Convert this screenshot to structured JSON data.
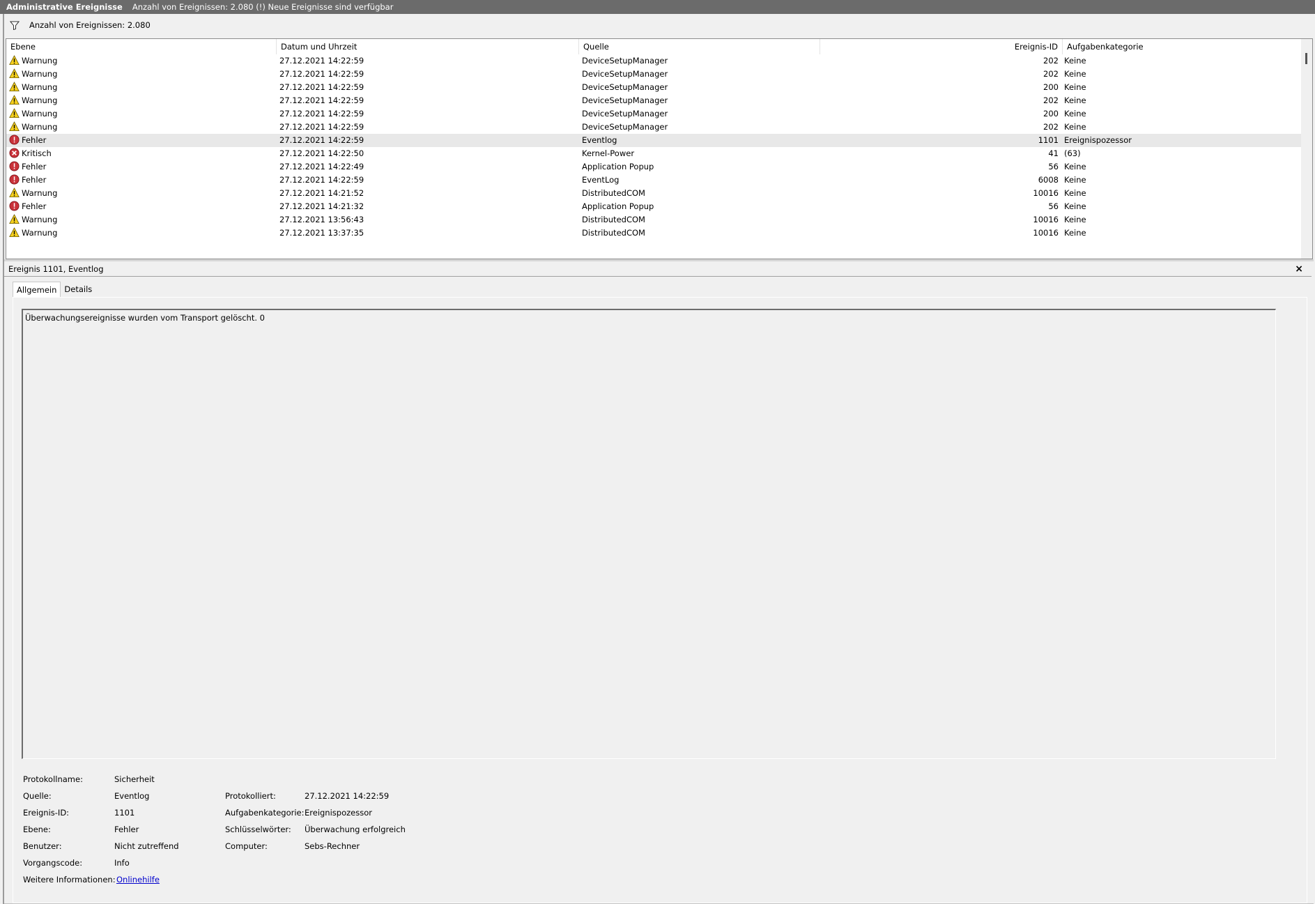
{
  "titlebar": {
    "title": "Administrative Ereignisse",
    "status": "Anzahl von Ereignissen: 2.080 (!) Neue Ereignisse sind verfügbar"
  },
  "filterbar": {
    "text": "Anzahl von Ereignissen: 2.080",
    "icon": "filter-icon"
  },
  "grid": {
    "columns": [
      "Ebene",
      "Datum und Uhrzeit",
      "Quelle",
      "Ereignis-ID",
      "Aufgabenkategorie"
    ],
    "rows": [
      {
        "level": "Warnung",
        "icon": "warning",
        "date": "27.12.2021 14:22:59",
        "source": "DeviceSetupManager",
        "id": "202",
        "category": "Keine"
      },
      {
        "level": "Warnung",
        "icon": "warning",
        "date": "27.12.2021 14:22:59",
        "source": "DeviceSetupManager",
        "id": "202",
        "category": "Keine"
      },
      {
        "level": "Warnung",
        "icon": "warning",
        "date": "27.12.2021 14:22:59",
        "source": "DeviceSetupManager",
        "id": "200",
        "category": "Keine"
      },
      {
        "level": "Warnung",
        "icon": "warning",
        "date": "27.12.2021 14:22:59",
        "source": "DeviceSetupManager",
        "id": "202",
        "category": "Keine"
      },
      {
        "level": "Warnung",
        "icon": "warning",
        "date": "27.12.2021 14:22:59",
        "source": "DeviceSetupManager",
        "id": "200",
        "category": "Keine"
      },
      {
        "level": "Warnung",
        "icon": "warning",
        "date": "27.12.2021 14:22:59",
        "source": "DeviceSetupManager",
        "id": "202",
        "category": "Keine"
      },
      {
        "level": "Fehler",
        "icon": "error",
        "date": "27.12.2021 14:22:59",
        "source": "Eventlog",
        "id": "1101",
        "category": "Ereignispozessor",
        "selected": true
      },
      {
        "level": "Kritisch",
        "icon": "critical",
        "date": "27.12.2021 14:22:50",
        "source": "Kernel-Power",
        "id": "41",
        "category": "(63)"
      },
      {
        "level": "Fehler",
        "icon": "error",
        "date": "27.12.2021 14:22:49",
        "source": "Application Popup",
        "id": "56",
        "category": "Keine"
      },
      {
        "level": "Fehler",
        "icon": "error",
        "date": "27.12.2021 14:22:59",
        "source": "EventLog",
        "id": "6008",
        "category": "Keine"
      },
      {
        "level": "Warnung",
        "icon": "warning",
        "date": "27.12.2021 14:21:52",
        "source": "DistributedCOM",
        "id": "10016",
        "category": "Keine"
      },
      {
        "level": "Fehler",
        "icon": "error",
        "date": "27.12.2021 14:21:32",
        "source": "Application Popup",
        "id": "56",
        "category": "Keine"
      },
      {
        "level": "Warnung",
        "icon": "warning",
        "date": "27.12.2021 13:56:43",
        "source": "DistributedCOM",
        "id": "10016",
        "category": "Keine"
      },
      {
        "level": "Warnung",
        "icon": "warning",
        "date": "27.12.2021 13:37:35",
        "source": "DistributedCOM",
        "id": "10016",
        "category": "Keine"
      }
    ]
  },
  "detail": {
    "title": "Ereignis 1101, Eventlog",
    "close": "×",
    "tabs": [
      "Allgemein",
      "Details"
    ],
    "description": "Überwachungsereignisse wurden vom Transport gelöscht. 0",
    "props": {
      "log_name_label": "Protokollname:",
      "log_name": "Sicherheit",
      "source_label": "Quelle:",
      "source": "Eventlog",
      "logged_label": "Protokolliert:",
      "logged": "27.12.2021 14:22:59",
      "event_id_label": "Ereignis-ID:",
      "event_id": "1101",
      "task_label": "Aufgabenkategorie:",
      "task": "Ereignispozessor",
      "level_label": "Ebene:",
      "level": "Fehler",
      "keywords_label": "Schlüsselwörter:",
      "keywords": "Überwachung erfolgreich",
      "user_label": "Benutzer:",
      "user": "Nicht zutreffend",
      "computer_label": "Computer:",
      "computer": "Sebs-Rechner",
      "opcode_label": "Vorgangscode:",
      "opcode": "Info",
      "more_info_label": "Weitere Informationen:",
      "more_info_link": "Onlinehilfe"
    }
  }
}
